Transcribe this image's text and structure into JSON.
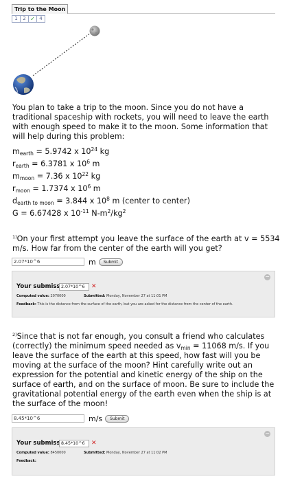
{
  "header": {
    "title": "Trip to the Moon"
  },
  "steps": [
    {
      "label": "1",
      "done": false
    },
    {
      "label": "2",
      "done": false
    },
    {
      "label": "✓",
      "done": true
    },
    {
      "label": "4",
      "done": false
    }
  ],
  "intro": "You plan to take a trip to the moon. Since you do not have a traditional spaceship with rockets, you will need to leave the earth with enough speed to make it to the moon. Some information that will help during this problem:",
  "given": {
    "m_earth": {
      "sym": "m",
      "sub": "earth",
      "val": " = 5.9742 x 10",
      "exp": "24",
      "unit": " kg"
    },
    "r_earth": {
      "sym": "r",
      "sub": "earth",
      "val": " = 6.3781 x 10",
      "exp": "6",
      "unit": " m"
    },
    "m_moon": {
      "sym": "m",
      "sub": "moon",
      "val": " = 7.36 x 10",
      "exp": "22",
      "unit": " kg"
    },
    "r_moon": {
      "sym": "r",
      "sub": "moon",
      "val": " = 1.7374 x 10",
      "exp": "6",
      "unit": " m"
    },
    "d": {
      "sym": "d",
      "sub": "earth to moon",
      "val": " = 3.844 x 10",
      "exp": "8",
      "unit": " m (center to center)"
    },
    "G": {
      "pre": "G = 6.67428 x 10",
      "exp1": "-11",
      "mid": " N-m",
      "exp2": "2",
      "mid2": "/kg",
      "exp3": "2"
    }
  },
  "q1": {
    "num": "1)",
    "text_pre": "On your first attempt you leave the surface of the earth at v = 5534 m/s. How far from the center of the earth will you get?",
    "input_value": "2.07*10^6",
    "unit": "m",
    "submit_label": "Submit",
    "submission": {
      "label": "Your submissions:",
      "value": "2.07*10^6",
      "computed_label": "Computed value:",
      "computed_value": "2070000",
      "submitted_label": "Submitted:",
      "submitted_value": "Monday, November 27 at 11:01 PM",
      "feedback_label": "Feedback:",
      "feedback_text": "This is the distance from the surface of the earth, but you are asked for the distance from the center of the earth."
    }
  },
  "q2": {
    "num": "2)",
    "text_a": "Since that is not far enough, you consult a friend who calculates (correctly) the minimum speed needed as v",
    "text_sub": "min",
    "text_b": " = 11068 m/s. If you leave the surface of the earth at this speed, how fast will you be moving at the surface of the moon? Hint carefully write out an expression for the potential and kinetic energy of the ship on the surface of earth, and on the surface of moon. Be sure to include the gravitational potential energy of the earth even when the ship is at the surface of the moon!",
    "input_value": "8.45*10^6",
    "unit": "m/s",
    "submit_label": "Submit",
    "submission": {
      "label": "Your submissions:",
      "value": "8.45*10^6",
      "computed_label": "Computed value:",
      "computed_value": "8450000",
      "submitted_label": "Submitted:",
      "submitted_value": "Monday, November 27 at 11:02 PM",
      "feedback_label": "Feedback:",
      "feedback_text": ""
    }
  },
  "colors": {
    "earth_ocean": "#2a55a8",
    "moon": "#9a9a9a",
    "error": "#d02020",
    "check": "#2e9a2e"
  }
}
